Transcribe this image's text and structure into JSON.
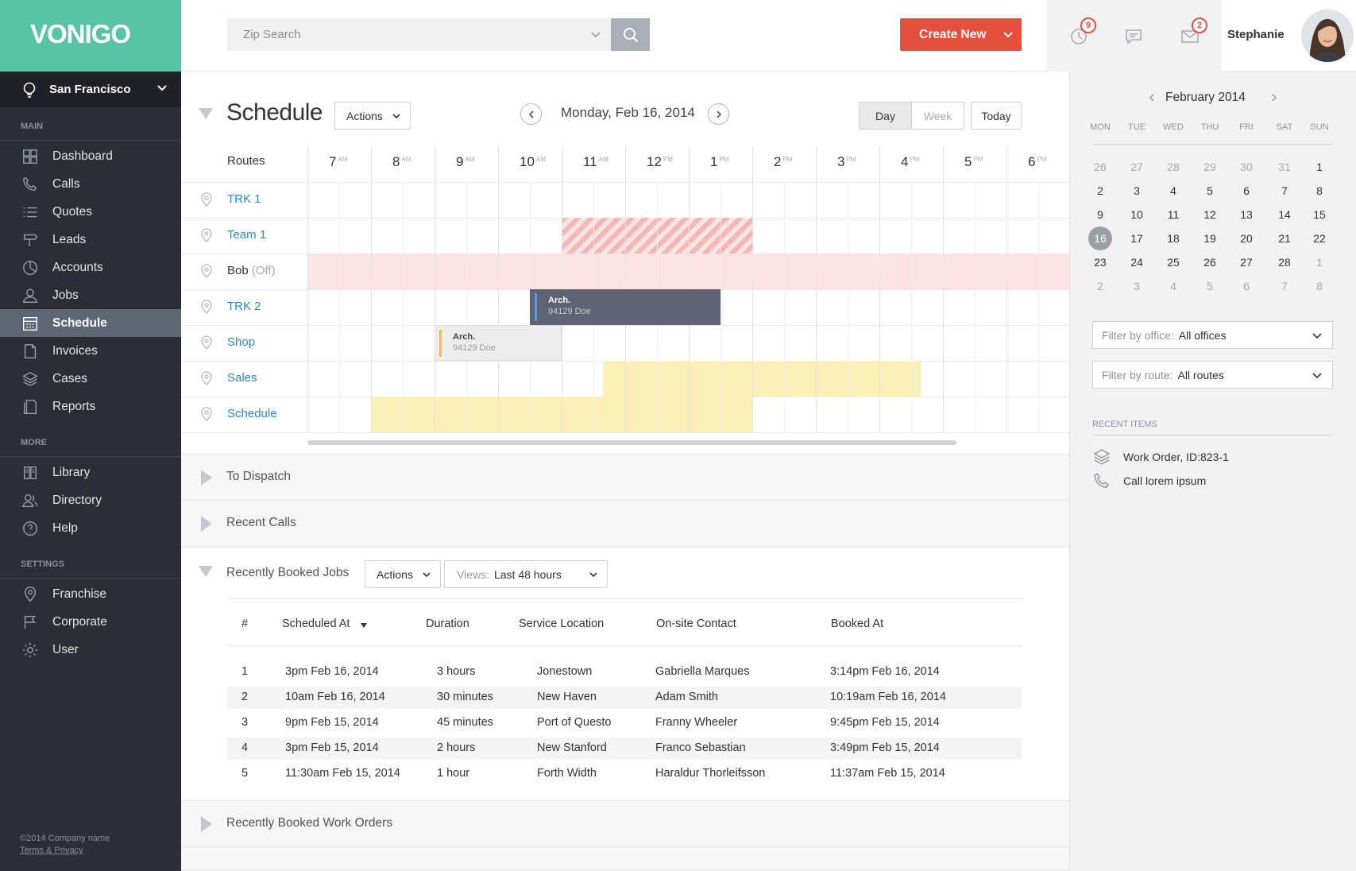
{
  "app": {
    "logo": "VONIGO",
    "city": "San Francisco"
  },
  "sidebar": {
    "main_label": "MAIN",
    "main_items": [
      {
        "label": "Dashboard",
        "icon": "grid-icon"
      },
      {
        "label": "Calls",
        "icon": "phone-icon"
      },
      {
        "label": "Quotes",
        "icon": "list-icon"
      },
      {
        "label": "Leads",
        "icon": "sign-icon"
      },
      {
        "label": "Accounts",
        "icon": "pie-icon"
      },
      {
        "label": "Jobs",
        "icon": "user-icon"
      },
      {
        "label": "Schedule",
        "icon": "calendar-icon",
        "active": true
      },
      {
        "label": "Invoices",
        "icon": "document-icon"
      },
      {
        "label": "Cases",
        "icon": "layers-icon"
      },
      {
        "label": "Reports",
        "icon": "reports-icon"
      }
    ],
    "more_label": "MORE",
    "more_items": [
      {
        "label": "Library",
        "icon": "book-icon"
      },
      {
        "label": "Directory",
        "icon": "users-icon"
      },
      {
        "label": "Help",
        "icon": "help-icon"
      }
    ],
    "settings_label": "SETTINGS",
    "settings_items": [
      {
        "label": "Franchise",
        "icon": "location-icon"
      },
      {
        "label": "Corporate",
        "icon": "flag-icon"
      },
      {
        "label": "User",
        "icon": "gear-icon"
      }
    ],
    "footer": {
      "copyright": "©2014 Company name",
      "terms": "Terms & Privacy"
    }
  },
  "topbar": {
    "search_placeholder": "Zip Search",
    "create_label": "Create New",
    "clock_badge": "9",
    "mail_badge": "2",
    "user_name": "Stephanie"
  },
  "schedule": {
    "title": "Schedule",
    "actions_label": "Actions",
    "date_label": "Monday, Feb 16, 2014",
    "view_day": "Day",
    "view_week": "Week",
    "today_label": "Today",
    "routes_header": "Routes",
    "hours": [
      {
        "h": "7",
        "ap": "AM"
      },
      {
        "h": "8",
        "ap": "AM"
      },
      {
        "h": "9",
        "ap": "AM"
      },
      {
        "h": "10",
        "ap": "AM"
      },
      {
        "h": "11",
        "ap": "AM"
      },
      {
        "h": "12",
        "ap": "PM"
      },
      {
        "h": "1",
        "ap": "PM"
      },
      {
        "h": "2",
        "ap": "PM"
      },
      {
        "h": "3",
        "ap": "PM"
      },
      {
        "h": "4",
        "ap": "PM"
      },
      {
        "h": "5",
        "ap": "PM"
      },
      {
        "h": "6",
        "ap": "PM"
      }
    ],
    "routes": [
      {
        "name": "TRK 1",
        "link": true
      },
      {
        "name": "Team 1",
        "link": true
      },
      {
        "name": "Bob",
        "suffix": "(Off)",
        "link": false
      },
      {
        "name": "TRK 2",
        "link": true
      },
      {
        "name": "Shop",
        "link": true
      },
      {
        "name": "Sales",
        "link": true
      },
      {
        "name": "Schedule",
        "link": true
      }
    ],
    "events": [
      {
        "title": "Arch.",
        "sub": "94129 Doe",
        "route": "TRK 2"
      },
      {
        "title": "Arch.",
        "sub": "94129 Doe",
        "route": "Shop"
      }
    ],
    "colors": {
      "accent": "#2a88c8",
      "off": "#fce4e4",
      "event_dark": "#5d6372",
      "yellow": "#fbf1b8",
      "hatch": "#f4b7b4"
    }
  },
  "panels": {
    "to_dispatch": "To Dispatch",
    "recent_calls": "Recent Calls",
    "recently_booked_jobs": "Recently Booked Jobs",
    "recently_booked_work_orders": "Recently Booked Work Orders",
    "jobs_actions": "Actions",
    "views_key": "Views:",
    "views_value": "Last 48 hours"
  },
  "jobs_table": {
    "headers": [
      "#",
      "Scheduled At",
      "Duration",
      "Service Location",
      "On-site Contact",
      "Booked At"
    ],
    "rows": [
      [
        "1",
        "3pm Feb 16, 2014",
        "3 hours",
        "Jonestown",
        "Gabriella Marques",
        "3:14pm Feb 16, 2014"
      ],
      [
        "2",
        "10am Feb 16, 2014",
        "30 minutes",
        "New Haven",
        "Adam Smith",
        "10:19am Feb 16, 2014"
      ],
      [
        "3",
        "9pm Feb 15, 2014",
        "45 minutes",
        "Port of Questo",
        "Franny Wheeler",
        "9:45pm Feb 15, 2014"
      ],
      [
        "4",
        "3pm Feb 15, 2014",
        "2 hours",
        "New Stanford",
        "Franco Sebastian",
        "3:49pm Feb 15, 2014"
      ],
      [
        "5",
        "11:30am Feb 15, 2014",
        "1 hour",
        "Forth Width",
        "Haraldur Thorleifsson",
        "11:37am Feb 15, 2014"
      ]
    ]
  },
  "calendar": {
    "month": "February 2014",
    "weekdays": [
      "MON",
      "TUE",
      "WED",
      "THU",
      "FRI",
      "SAT",
      "SUN"
    ],
    "weeks": [
      [
        "26",
        "27",
        "28",
        "29",
        "30",
        "31",
        "1"
      ],
      [
        "2",
        "3",
        "4",
        "5",
        "6",
        "7",
        "8"
      ],
      [
        "9",
        "10",
        "11",
        "12",
        "13",
        "14",
        "15"
      ],
      [
        "16",
        "17",
        "18",
        "19",
        "20",
        "21",
        "22"
      ],
      [
        "23",
        "24",
        "25",
        "26",
        "27",
        "28",
        "1"
      ],
      [
        "2",
        "3",
        "4",
        "5",
        "6",
        "7",
        "8"
      ]
    ],
    "selected": "16"
  },
  "filters": {
    "office_key": "Filter by office:",
    "office_value": "All offices",
    "route_key": "Filter by route:",
    "route_value": "All routes"
  },
  "recent_items": {
    "title": "RECENT ITEMS",
    "items": [
      {
        "label": "Work Order, ID:823-1",
        "icon": "layers-icon"
      },
      {
        "label": "Call lorem ipsum",
        "icon": "phone-icon"
      }
    ]
  }
}
